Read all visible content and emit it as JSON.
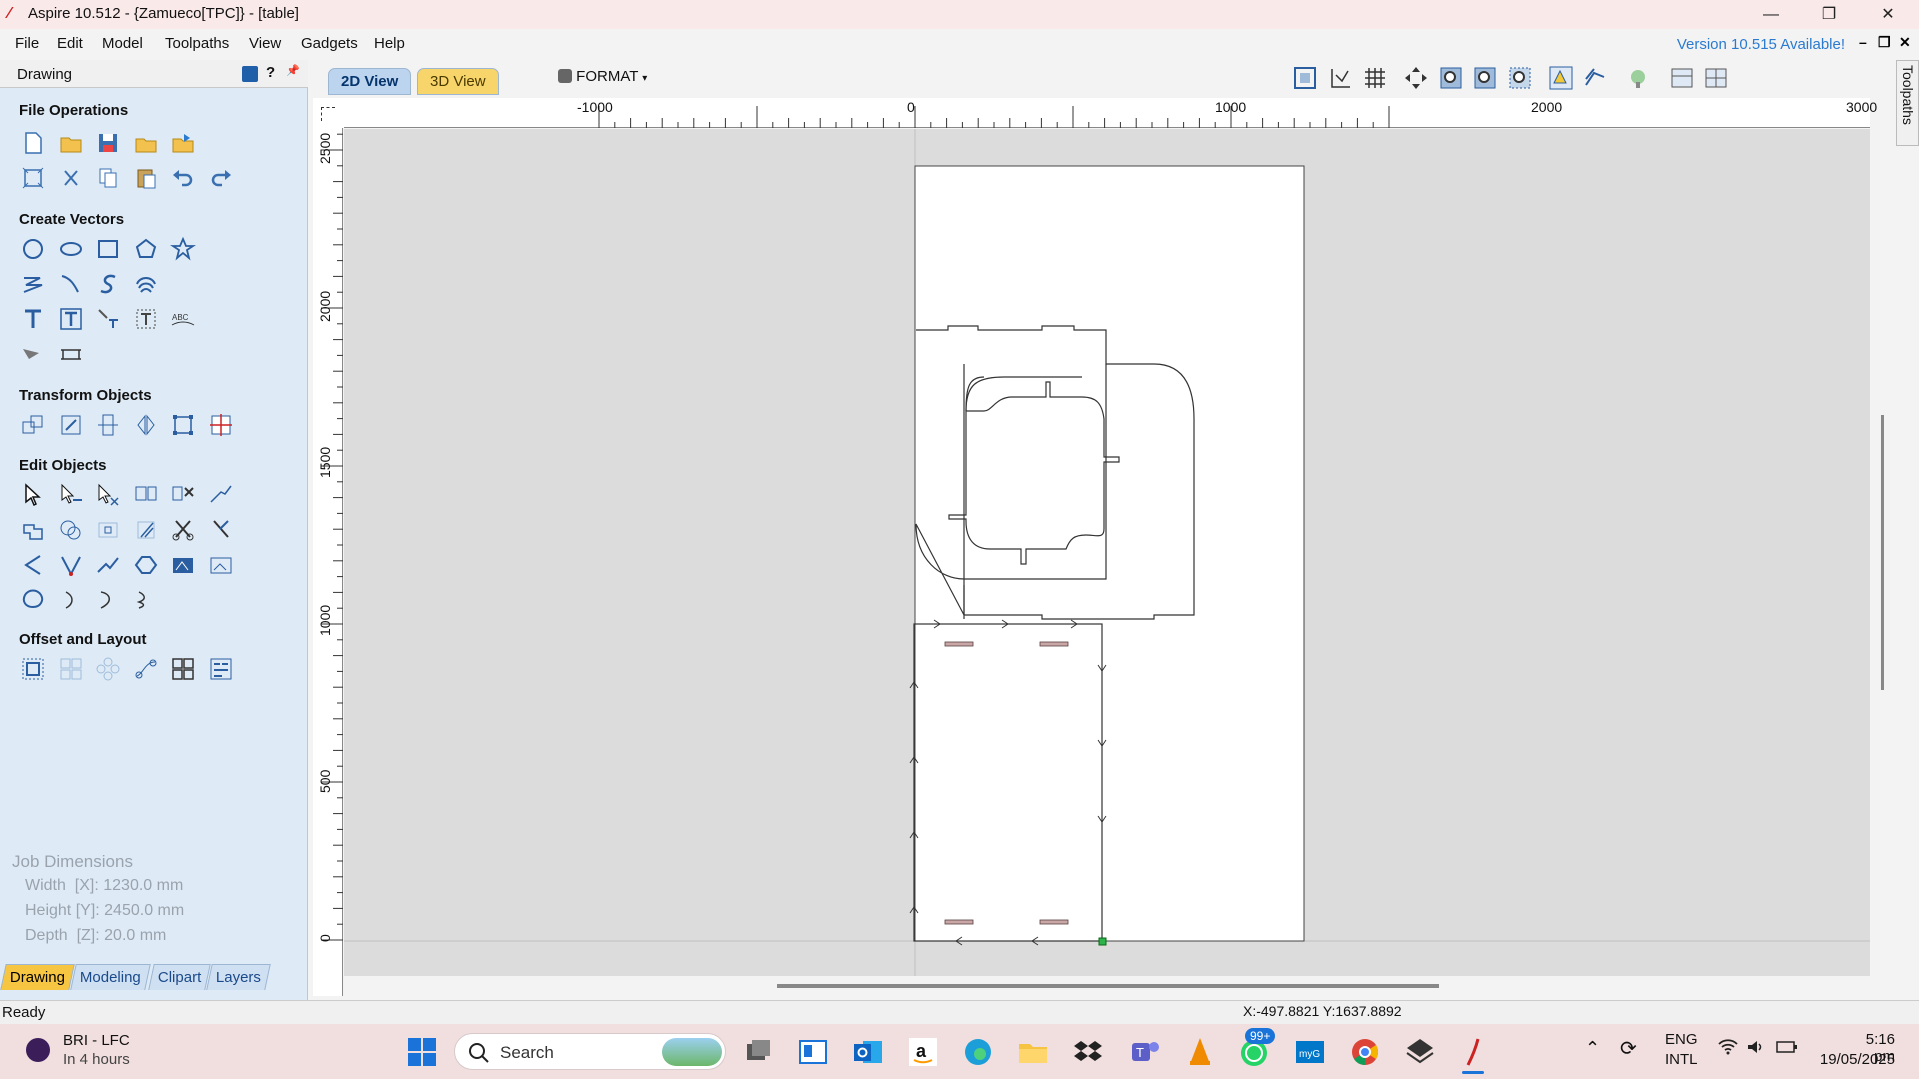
{
  "titlebar": {
    "title": "Aspire 10.512 - {Zamueco[TPC]} - [table]",
    "minimize": "—",
    "restore": "❐",
    "close": "✕"
  },
  "menu": [
    "File",
    "Edit",
    "Model",
    "Toolpaths",
    "View",
    "Gadgets",
    "Help"
  ],
  "version_notice": "Version 10.515 Available!",
  "mdi": {
    "min": "–",
    "restore": "❐",
    "close": "✕"
  },
  "panel": {
    "title": "Drawing",
    "header_buttons": [
      "?",
      "📌"
    ],
    "sections": [
      "File Operations",
      "Create Vectors",
      "Transform Objects",
      "Edit Objects",
      "Offset and Layout"
    ],
    "job": {
      "title": "Job Dimensions",
      "width": "Width  [X]: 1230.0 mm",
      "height": "Height [Y]: 2450.0 mm",
      "depth": "Depth  [Z]: 20.0 mm"
    },
    "tabs": [
      "Drawing",
      "Modeling",
      "Clipart",
      "Layers"
    ]
  },
  "view": {
    "tab2d": "2D View",
    "tab3d": "3D View",
    "format": "FORMAT"
  },
  "ruler": {
    "h": [
      "-1000",
      "0",
      "1000",
      "2000",
      "3000"
    ],
    "v": [
      "2500",
      "2000",
      "1500",
      "1000",
      "500",
      "0"
    ]
  },
  "side_tab": "Toolpaths",
  "status": {
    "text": "Ready",
    "coords": "X:-497.8821 Y:1637.8892"
  },
  "taskbar": {
    "weather_title": "BRI - LFC",
    "weather_sub": "In 4 hours",
    "search_placeholder": "Search",
    "badge": "99+",
    "lang1": "ENG",
    "lang2": "INTL",
    "time": "5:16 pm",
    "date": "19/05/2025"
  },
  "colors": {
    "accent": "#2a7bd0",
    "panel": "#deebf7",
    "tab_active": "#f6c542"
  }
}
